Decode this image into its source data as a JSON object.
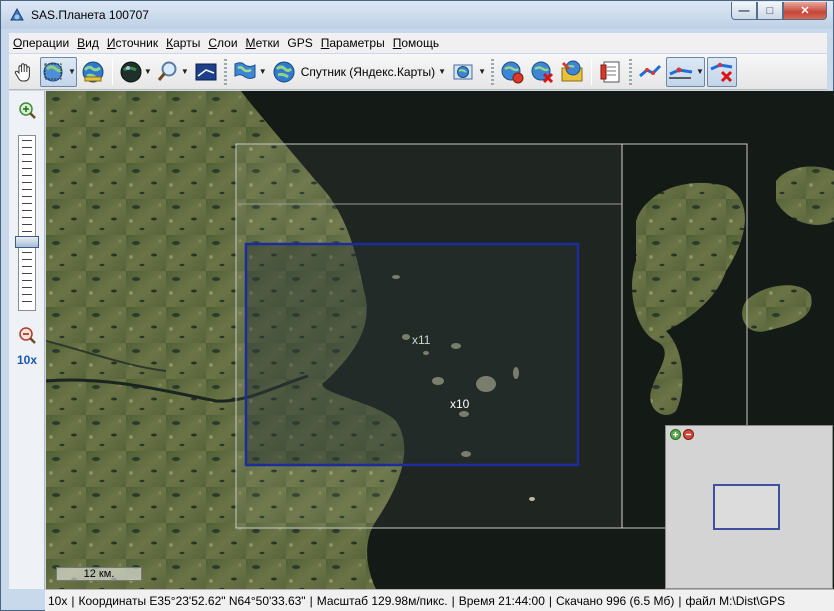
{
  "window": {
    "title": "SAS.Планета 100707",
    "controls": {
      "minimize": "—",
      "maximize": "□",
      "close": "✕"
    }
  },
  "menu": [
    {
      "label": "Операции",
      "underline": "О",
      "rest": "перации"
    },
    {
      "label": "Вид",
      "underline": "В",
      "rest": "ид"
    },
    {
      "label": "Источник",
      "underline": "И",
      "rest": "сточник"
    },
    {
      "label": "Карты",
      "underline": "К",
      "rest": "арты"
    },
    {
      "label": "Слои",
      "underline": "С",
      "rest": "лои"
    },
    {
      "label": "Метки",
      "underline": "М",
      "rest": "етки"
    },
    {
      "label": "GPS",
      "underline": "",
      "rest": "GPS"
    },
    {
      "label": "Параметры",
      "underline": "П",
      "rest": "араметры"
    },
    {
      "label": "Помощь",
      "underline": "П",
      "rest": "омощь"
    }
  ],
  "toolbar": {
    "map_source_label": "Спутник (Яндекс.Карты)",
    "icons": [
      "hand-pan-icon",
      "select-region-icon",
      "globe-icon",
      "planet-icon",
      "magnifier-icon",
      "map-view-icon",
      "world-flag-icon",
      "globe-source-icon",
      "layers-icon",
      "ball-download-icon",
      "ball-delete-icon",
      "ball-folder-icon",
      "document-list-icon",
      "gps-track-icon",
      "gps-route-icon",
      "gps-delete-icon"
    ]
  },
  "left_panel": {
    "zoom_in": "+",
    "zoom_out": "−",
    "zoom_level": "10x"
  },
  "map": {
    "scale_label": "12 км.",
    "labels": {
      "x11": "x11",
      "x10": "x10"
    }
  },
  "status": {
    "zoom": "10x",
    "coordinates": "Координаты E35°23'52.62\" N64°50'33.63\"",
    "scale": "Масштаб 129.98м/пикс.",
    "time": "Время 21:44:00",
    "downloaded": "Скачано 996 (6.5 Мб)",
    "file": "файл M:\\Dist\\GPS"
  },
  "colors": {
    "accent": "#1a56b0",
    "selection_blue": "#1c2c9c",
    "sea": "#141a16",
    "land": "#5c6b3c"
  }
}
